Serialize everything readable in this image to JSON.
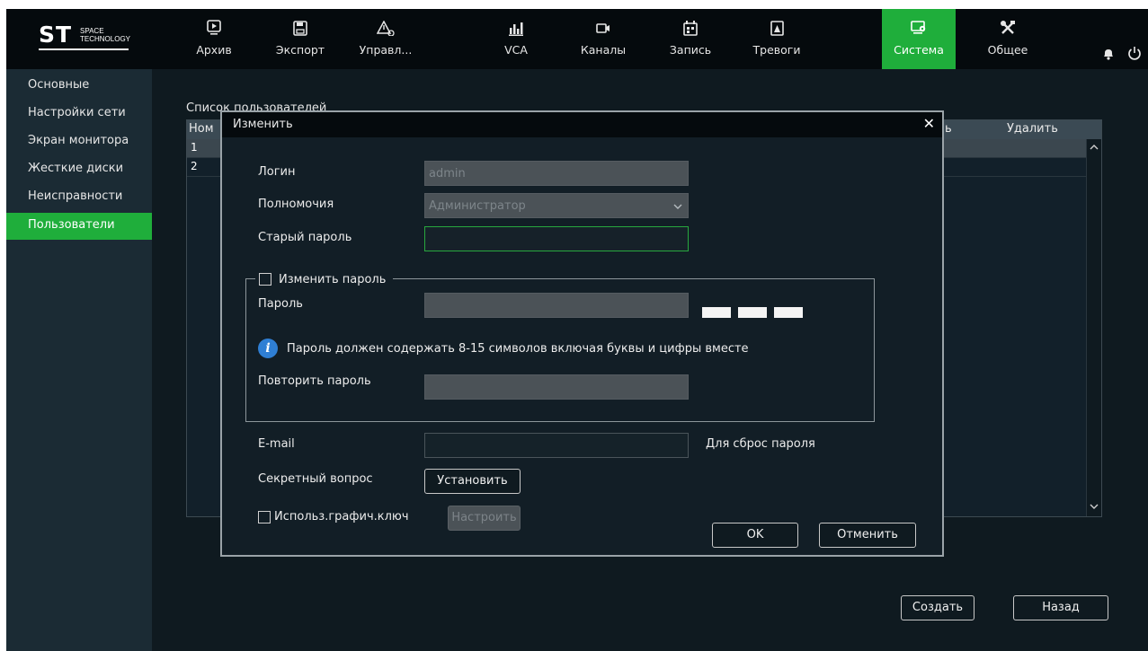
{
  "brand": {
    "letters": "ST",
    "sub_line1": "SPACE",
    "sub_line2": "TECHNOLOGY"
  },
  "nav": [
    {
      "label": "Архив",
      "icon": "playback-icon"
    },
    {
      "label": "Экспорт",
      "icon": "floppy-icon"
    },
    {
      "label": "Управл...",
      "icon": "warning-user-icon"
    },
    {
      "label": "VCA",
      "icon": "chart-icon"
    },
    {
      "label": "Каналы",
      "icon": "camera-icon"
    },
    {
      "label": "Запись",
      "icon": "calendar-icon"
    },
    {
      "label": "Тревоги",
      "icon": "alarm-icon"
    },
    {
      "label": "Система",
      "icon": "system-icon",
      "active": true
    },
    {
      "label": "Общее",
      "icon": "tools-icon"
    }
  ],
  "sidebar": {
    "items": [
      {
        "label": "Основные"
      },
      {
        "label": "Настройки сети"
      },
      {
        "label": "Экран монитора"
      },
      {
        "label": "Жесткие диски"
      },
      {
        "label": "Неисправности"
      },
      {
        "label": "Пользователи",
        "active": true
      }
    ]
  },
  "main": {
    "list_title": "Список пользователей",
    "table": {
      "headers": {
        "num": "Ном",
        "col_partial": "ь",
        "delete": "Удалить"
      },
      "rows": [
        {
          "num": "1"
        },
        {
          "num": "2"
        }
      ]
    },
    "create_label": "Создать",
    "back_label": "Назад"
  },
  "modal": {
    "title": "Изменить",
    "close": "✕",
    "login_label": "Логин",
    "login_value": "admin",
    "rights_label": "Полномочия",
    "rights_value": "Администратор",
    "old_password_label": "Старый пароль",
    "change_password_label": "Изменить пароль",
    "password_label": "Пароль",
    "info_text": "Пароль должен содержать 8-15 символов включая буквы и цифры вместе",
    "repeat_password_label": "Повторить пароль",
    "email_label": "E-mail",
    "email_hint": "Для сброс пароля",
    "secret_question_label": "Секретный вопрос",
    "set_button": "Установить",
    "pattern_label": "Использ.графич.ключ",
    "configure_button": "Настроить",
    "ok_button": "OK",
    "cancel_button": "Отменить"
  },
  "colors": {
    "accent": "#1fae3b",
    "background": "#0f1a20",
    "topbar": "#050a0d",
    "sidebar": "#1b2b34",
    "info": "#2f7fd4"
  }
}
